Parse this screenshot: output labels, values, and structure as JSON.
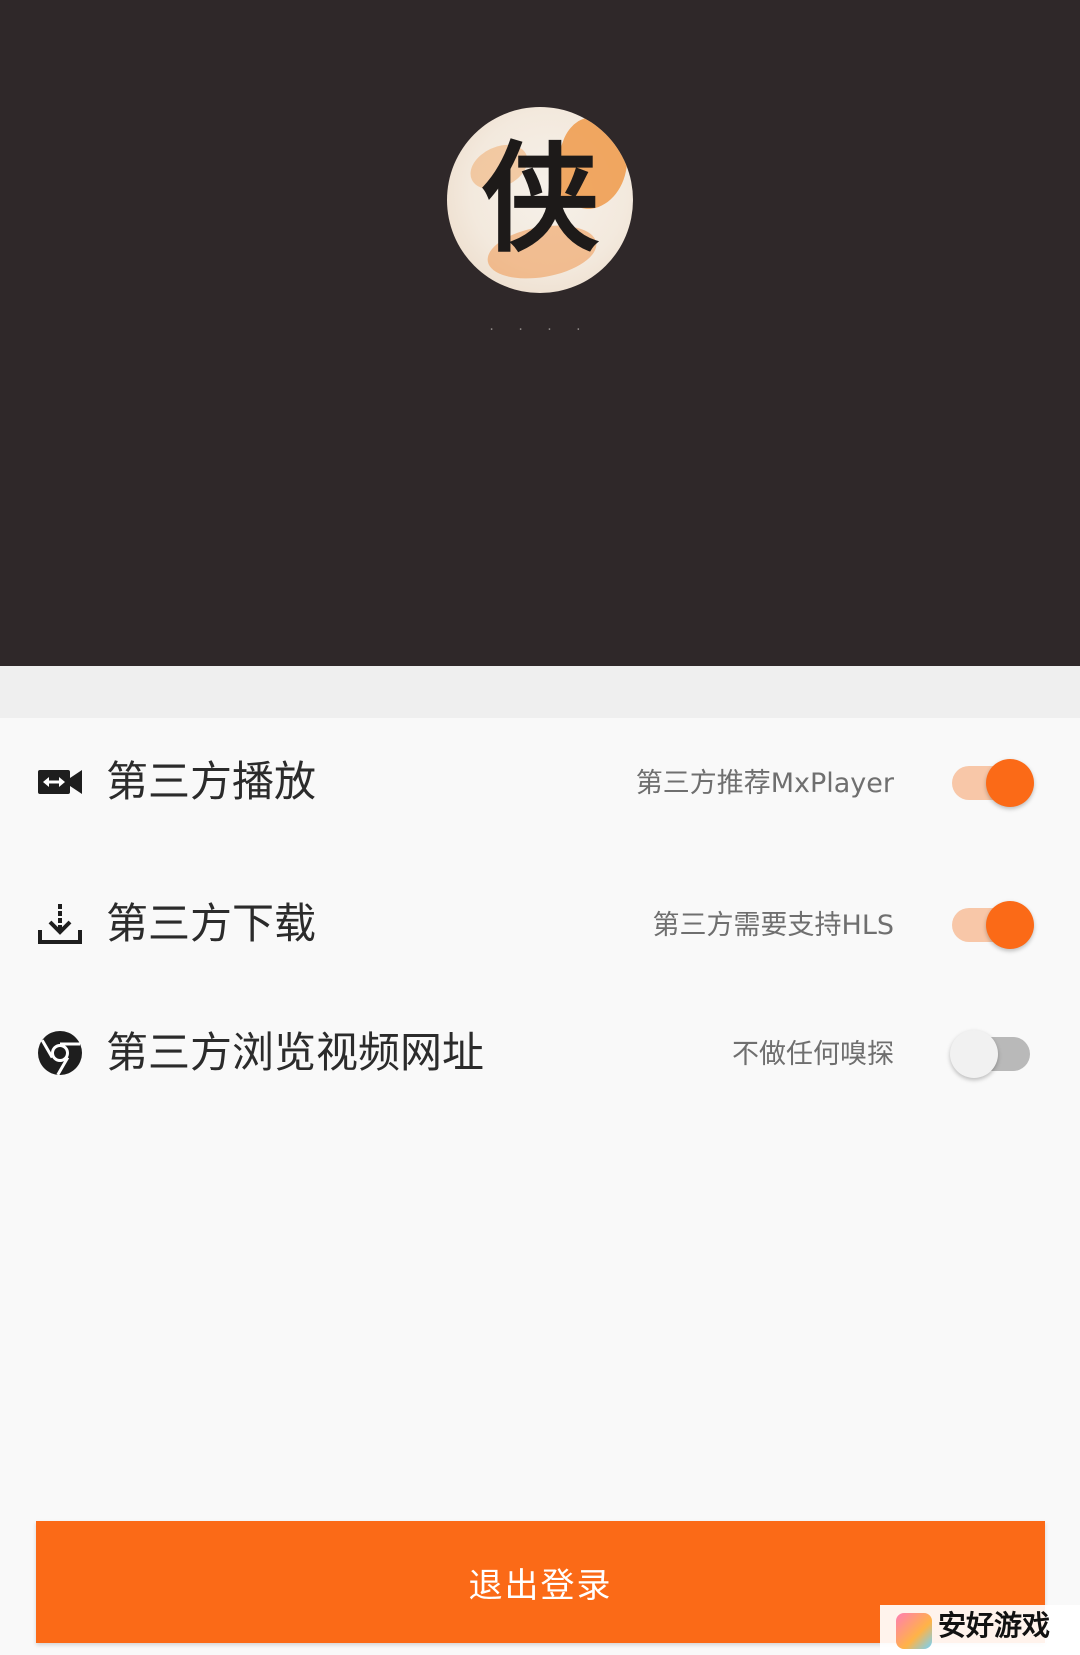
{
  "header": {
    "avatar_glyph": "侠",
    "username": ". . . ."
  },
  "settings": [
    {
      "label": "第三方播放",
      "hint": "第三方推荐MxPlayer",
      "icon": "external-player-icon",
      "enabled": true
    },
    {
      "label": "第三方下载",
      "hint": "第三方需要支持HLS",
      "icon": "download-icon",
      "enabled": true
    },
    {
      "label": "第三方浏览视频网址",
      "hint": "不做任何嗅探",
      "icon": "browser-icon",
      "enabled": false
    }
  ],
  "logout": {
    "label": "退出登录"
  },
  "watermark": {
    "text": "安好游戏"
  },
  "colors": {
    "header_bg": "#2f2829",
    "accent": "#fb6a17",
    "accent_track": "#f8c7a8",
    "off_track": "#b9b9b9",
    "off_thumb": "#f1f1f1",
    "page_bg": "#f9f9f9"
  }
}
